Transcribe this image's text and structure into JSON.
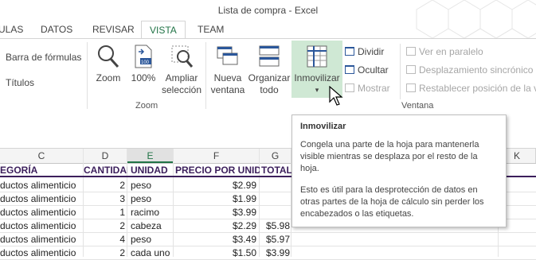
{
  "window": {
    "title": "Lista de compra - Excel"
  },
  "tabs": [
    {
      "label": "ULAS"
    },
    {
      "label": "DATOS"
    },
    {
      "label": "REVISAR"
    },
    {
      "label": "VISTA",
      "active": true
    },
    {
      "label": "TEAM"
    }
  ],
  "ribbon": {
    "show": {
      "formula_bar": "Barra de fórmulas",
      "headings": "Títulos"
    },
    "zoom": {
      "zoom": "Zoom",
      "zoom100": "100%",
      "zoom_sel_1": "Ampliar",
      "zoom_sel_2": "selección",
      "group": "Zoom"
    },
    "window": {
      "new_1": "Nueva",
      "new_2": "ventana",
      "arrange_1": "Organizar",
      "arrange_2": "todo",
      "freeze": "Inmovilizar",
      "freeze_arrow": "▾",
      "split": "Dividir",
      "hide": "Ocultar",
      "unhide": "Mostrar",
      "side_by_side": "Ver en paralelo",
      "sync_scroll": "Desplazamiento sincrónico",
      "reset_pos": "Restablecer posición de la v",
      "group": "Ventana"
    }
  },
  "grid": {
    "columns": [
      "C",
      "D",
      "E",
      "F",
      "G",
      "K"
    ],
    "header_row": [
      "EGORÍA",
      "CANTIDAD",
      "UNIDAD",
      "PRECIO POR UNIDA",
      "TOTAL"
    ],
    "rows": [
      [
        "ductos alimenticio",
        "2",
        "peso",
        "$2.99",
        ""
      ],
      [
        "ductos alimenticio",
        "3",
        "peso",
        "$1.99",
        ""
      ],
      [
        "ductos alimenticio",
        "1",
        "racimo",
        "$3.99",
        ""
      ],
      [
        "ductos alimenticio",
        "2",
        "cabeza",
        "$2.29",
        "$5.98"
      ],
      [
        "ductos alimenticio",
        "4",
        "peso",
        "$3.49",
        "$5.97"
      ],
      [
        "ductos alimenticio",
        "2",
        "cada uno",
        "$1.50",
        "$3.99"
      ]
    ]
  },
  "tooltip": {
    "title": "Inmovilizar",
    "p1": "Congela una parte de la hoja para mantenerla visible mientras se desplaza por el resto de la hoja.",
    "p2": "Esto es útil para la desprotección de datos en otras partes de la hoja de cálculo sin perder los encabezados o las etiquetas."
  },
  "colors": {
    "accent": "#217346",
    "header_text": "#3b1e5b",
    "freeze_highlight": "#cfe8d4"
  }
}
